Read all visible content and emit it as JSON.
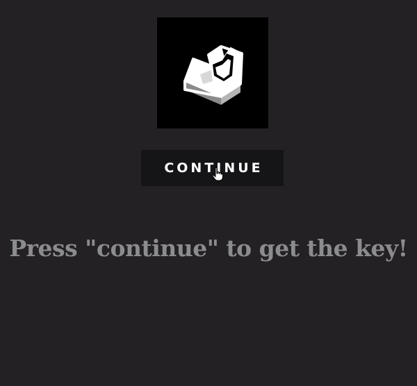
{
  "logo": {
    "icon": "y-block-logo-icon"
  },
  "button": {
    "label": "CONTINUE"
  },
  "cursor": {
    "icon": "hand-pointer-icon"
  },
  "message": {
    "text": "Press \"continue\" to get the key!"
  },
  "colors": {
    "background": "#232124",
    "logo_background": "#000000",
    "button_background": "#151416",
    "button_text": "#ffffff",
    "message_text": "#8c8b8e"
  }
}
